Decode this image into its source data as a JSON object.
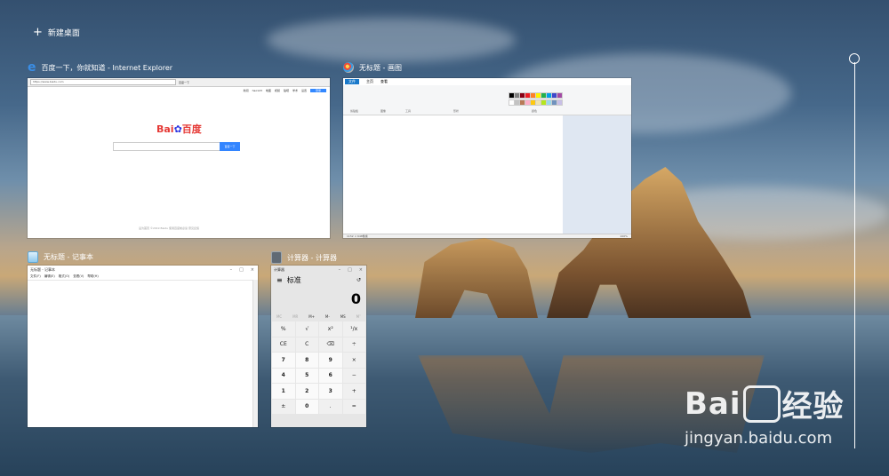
{
  "new_desktop": {
    "label": "新建桌面"
  },
  "windows": {
    "ie": {
      "title": "百度一下，你就知道 - Internet Explorer",
      "address": "https://www.baidu.com",
      "tab": "百度一下",
      "nav": [
        "新闻",
        "hao123",
        "地图",
        "视频",
        "贴吧",
        "学术",
        "设置"
      ],
      "login": "登录",
      "logo_text": "Bai",
      "logo_text2": "百度",
      "search_button": "百度一下",
      "footer": "设为首页 ©2019 Baidu 使用百度前必读 意见反馈"
    },
    "paint": {
      "title": "无标题 - 画图",
      "tabs": [
        "文件",
        "主页",
        "查看"
      ],
      "groups": [
        "剪贴板",
        "图像",
        "工具",
        "形状",
        "颜色"
      ],
      "status_zoom": "100%",
      "status_size": "1152 × 648像素"
    },
    "notepad": {
      "title": "无标题 - 记事本",
      "inner_title": "无标题 - 记事本",
      "menu": [
        "文件(F)",
        "编辑(E)",
        "格式(O)",
        "查看(V)",
        "帮助(H)"
      ]
    },
    "calculator": {
      "title": "计算器 - 计算器",
      "inner_title": "计算器",
      "mode": "标准",
      "display": "0",
      "memory": [
        "MC",
        "MR",
        "M+",
        "M-",
        "MS",
        "M˅"
      ],
      "keys": [
        "%",
        "√",
        "x²",
        "¹/x",
        "CE",
        "C",
        "⌫",
        "÷",
        "7",
        "8",
        "9",
        "×",
        "4",
        "5",
        "6",
        "−",
        "1",
        "2",
        "3",
        "+",
        "±",
        "0",
        ".",
        "="
      ]
    }
  },
  "palette": [
    "#000000",
    "#7f7f7f",
    "#880015",
    "#ed1c24",
    "#ff7f27",
    "#fff200",
    "#22b14c",
    "#00a2e8",
    "#3f48cc",
    "#a349a4",
    "#ffffff",
    "#c3c3c3",
    "#b97a57",
    "#ffaec9",
    "#ffc90e",
    "#efe4b0",
    "#b5e61d",
    "#99d9ea",
    "#7092be",
    "#c8bfe7"
  ],
  "watermark": {
    "main_a": "Bai",
    "main_b": "经验",
    "sub": "jingyan.baidu.com"
  }
}
